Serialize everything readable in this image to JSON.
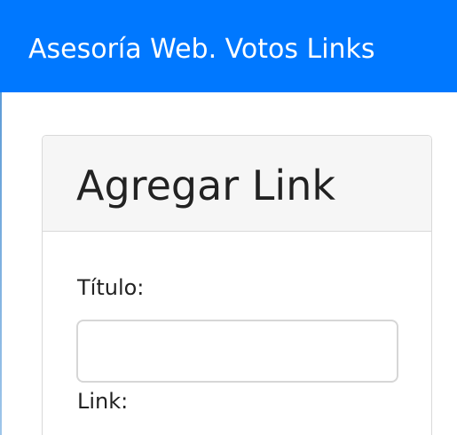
{
  "navbar": {
    "title": "Asesoría Web. Votos Links"
  },
  "card": {
    "title": "Agregar Link",
    "form": {
      "titulo_label": "Título:",
      "titulo_value": "",
      "titulo_placeholder": "",
      "link_label": "Link:"
    }
  },
  "colors": {
    "navbar_bg": "#0078ff",
    "card_header_bg": "#f6f6f6",
    "text": "#222222"
  }
}
